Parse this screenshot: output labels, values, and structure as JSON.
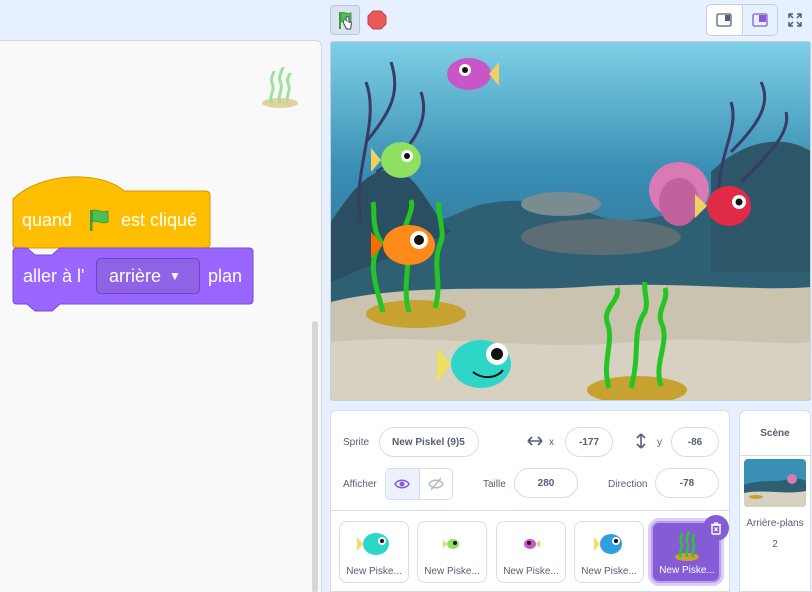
{
  "toolbar": {
    "green_flag_icon": "green-flag-icon",
    "stop_icon": "stop-icon",
    "small_stage_icon": "small-stage-icon",
    "normal_stage_icon": "normal-stage-icon",
    "fullscreen_icon": "fullscreen-icon"
  },
  "code": {
    "hat_block": {
      "text_before": "quand",
      "text_after": "est cliqué"
    },
    "layer_block": {
      "text_before": "aller à l'",
      "dropdown_value": "arrière",
      "text_after": "plan"
    }
  },
  "sprite_info": {
    "sprite_label": "Sprite",
    "sprite_name": "New Piskel (9)5",
    "x_label": "x",
    "x_value": "-177",
    "y_label": "y",
    "y_value": "-86",
    "show_label": "Afficher",
    "size_label": "Taille",
    "size_value": "280",
    "direction_label": "Direction",
    "direction_value": "-78"
  },
  "sprites": [
    {
      "name": "New Piske...",
      "icon": "cyan-fish-icon",
      "selected": false
    },
    {
      "name": "New Piske...",
      "icon": "green-fish-icon",
      "selected": false
    },
    {
      "name": "New Piske...",
      "icon": "pink-fish-icon",
      "selected": false
    },
    {
      "name": "New Piske...",
      "icon": "blue-fish-icon",
      "selected": false
    },
    {
      "name": "New Piske...",
      "icon": "seaweed-icon",
      "selected": true
    }
  ],
  "stage_pane": {
    "title": "Scène",
    "backdrops_label": "Arrière-plans",
    "backdrops_count": "2"
  },
  "colors": {
    "accent": "#855cd6",
    "events_block": "#ffbf00",
    "looks_block": "#9966ff"
  }
}
